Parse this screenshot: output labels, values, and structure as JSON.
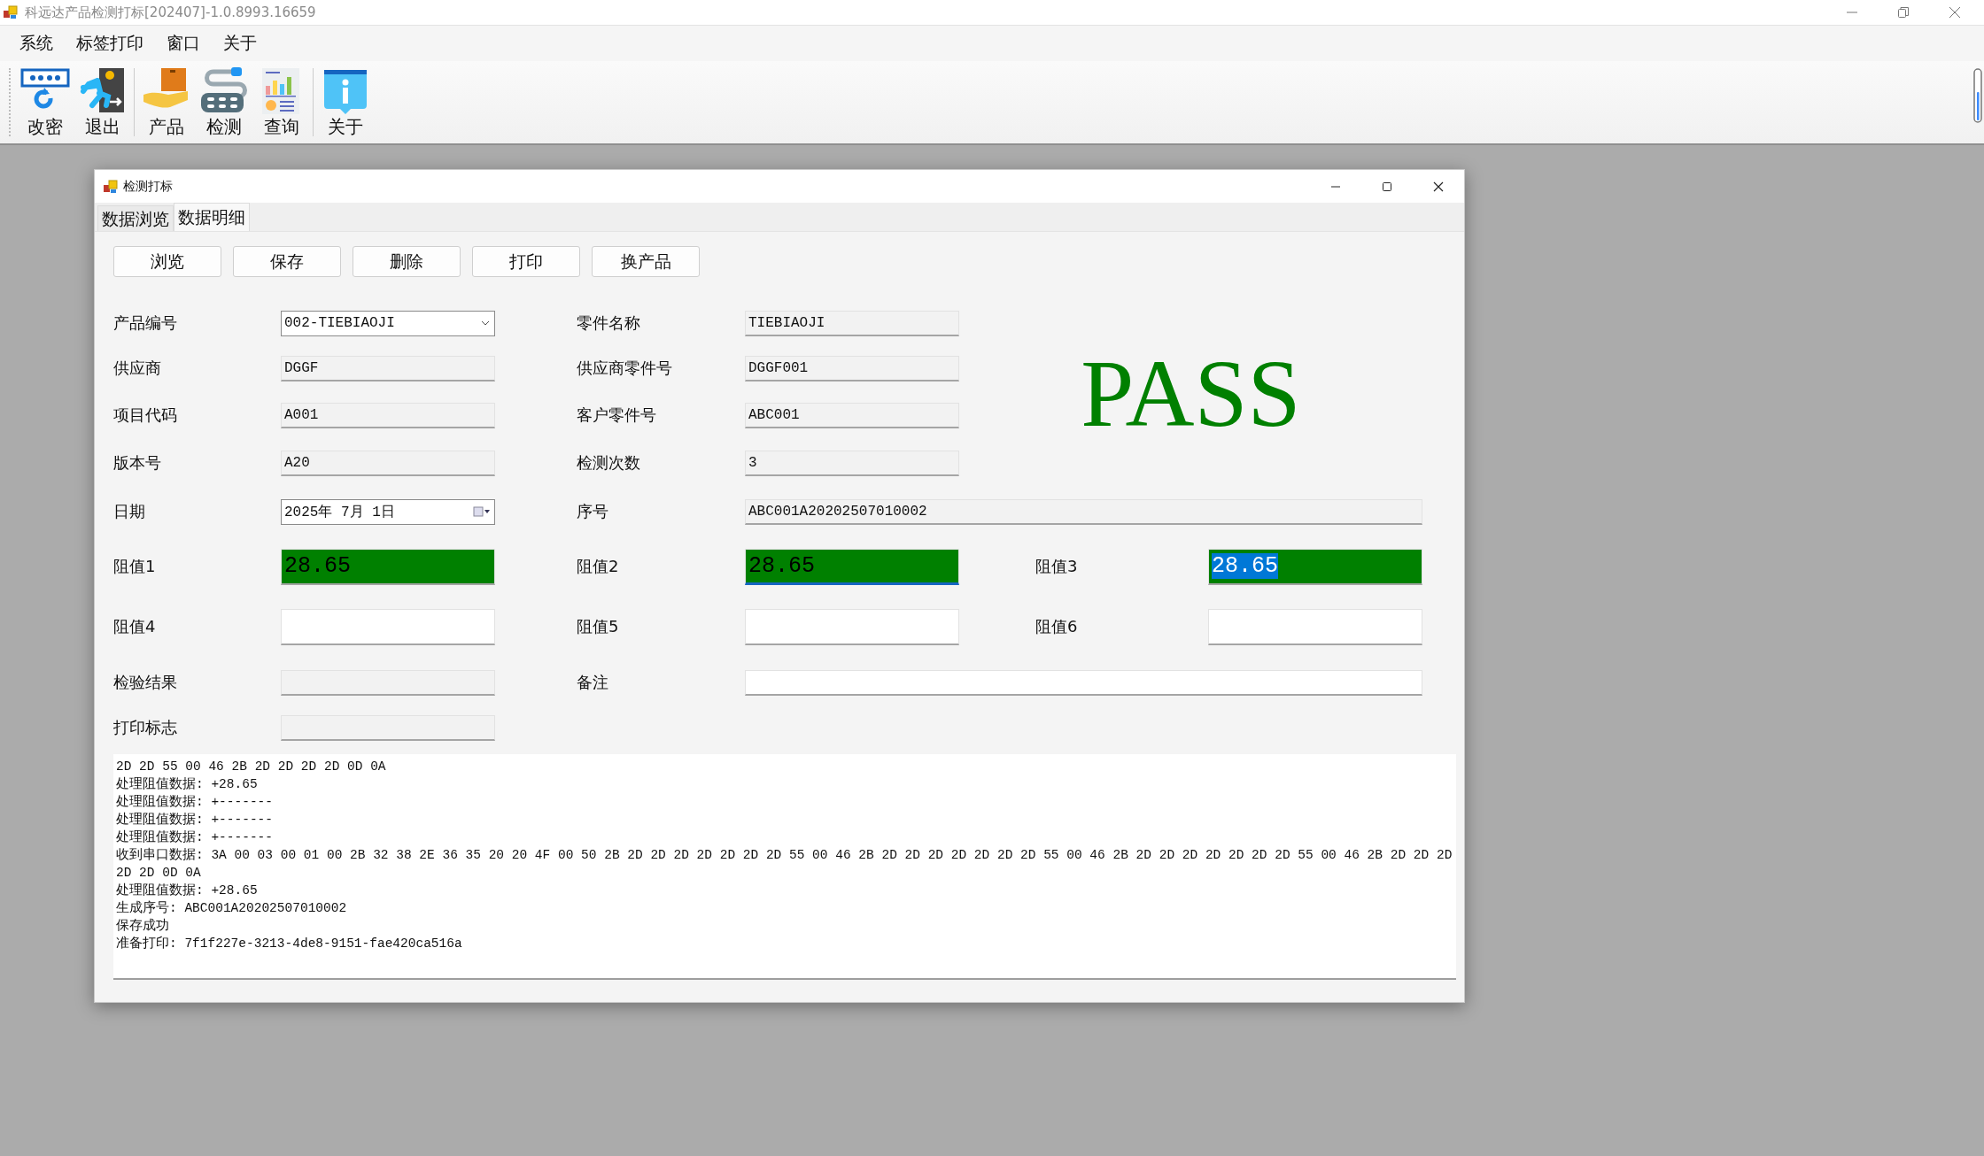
{
  "app": {
    "title": "科远达产品检测打标[202407]-1.0.8993.16659"
  },
  "menu": [
    "系统",
    "标签打印",
    "窗口",
    "关于"
  ],
  "toolbar": {
    "groups": [
      [
        {
          "label": "改密",
          "kind": "password"
        },
        {
          "label": "退出",
          "kind": "exit"
        }
      ],
      [
        {
          "label": "产品",
          "kind": "product"
        },
        {
          "label": "检测",
          "kind": "detect"
        },
        {
          "label": "查询",
          "kind": "query"
        }
      ],
      [
        {
          "label": "关于",
          "kind": "about"
        }
      ]
    ]
  },
  "child_window": {
    "title": "检测打标",
    "tabs": [
      {
        "label": "数据浏览",
        "selected": false
      },
      {
        "label": "数据明细",
        "selected": true
      }
    ],
    "buttons": [
      "浏览",
      "保存",
      "删除",
      "打印",
      "换产品"
    ],
    "rows": [
      [
        {
          "label": "产品编号",
          "kind": "combo",
          "value": "002-TIEBIAOJI"
        },
        {
          "label": "零件名称",
          "kind": "readonly",
          "value": "TIEBIAOJI"
        }
      ],
      [
        {
          "label": "供应商",
          "kind": "readonly",
          "value": "DGGF"
        },
        {
          "label": "供应商零件号",
          "kind": "readonly",
          "value": "DGGF001"
        }
      ],
      [
        {
          "label": "项目代码",
          "kind": "readonly",
          "value": "A001"
        },
        {
          "label": "客户零件号",
          "kind": "readonly",
          "value": "ABC001"
        }
      ],
      [
        {
          "label": "版本号",
          "kind": "readonly",
          "value": "A20"
        },
        {
          "label": "检测次数",
          "kind": "readonly",
          "value": "3"
        }
      ],
      [
        {
          "label": "日期",
          "kind": "date",
          "value": "2025年  7月  1日"
        },
        {
          "label": "序号",
          "kind": "readonly_wide",
          "value": "ABC001A20202507010002"
        }
      ],
      [
        {
          "label": "阻值1",
          "kind": "reading",
          "value": "28.65",
          "pass": true,
          "focused": false,
          "selected": false
        },
        {
          "label": "阻值2",
          "kind": "reading",
          "value": "28.65",
          "pass": true,
          "focused": true,
          "selected": false
        },
        {
          "label": "阻值3",
          "kind": "reading",
          "value": "28.65",
          "pass": true,
          "focused": false,
          "selected": true
        }
      ],
      [
        {
          "label": "阻值4",
          "kind": "reading",
          "pass": false,
          "focused": false,
          "selected": false
        },
        {
          "label": "阻值5",
          "kind": "reading",
          "pass": false,
          "focused": false,
          "selected": false
        },
        {
          "label": "阻值6",
          "kind": "reading",
          "pass": false,
          "focused": false,
          "selected": false
        }
      ],
      [
        {
          "label": "检验结果",
          "kind": "readonly"
        },
        {
          "label": "备注",
          "kind": "input_wide"
        }
      ],
      [
        {
          "label": "打印标志",
          "kind": "readonly"
        }
      ]
    ],
    "result": {
      "text": "PASS",
      "color": "#008000"
    },
    "log": [
      "2D 2D 55 00 46 2B 2D 2D 2D 2D 0D 0A",
      "处理阻值数据: +28.65",
      "处理阻值数据: +-------",
      "处理阻值数据: +-------",
      "处理阻值数据: +-------",
      "收到串口数据: 3A 00 03 00 01 00 2B 32 38 2E 36 35 20 20 4F 00 50 2B 2D 2D 2D 2D 2D 2D 2D 55 00 46 2B 2D 2D 2D 2D 2D 2D 2D 55 00 46 2B 2D 2D 2D 2D 2D 2D 2D 55 00 46 2B 2D 2D 2D 2D 2D 0D 0A",
      "处理阻值数据: +28.65",
      "生成序号: ABC001A20202507010002",
      "保存成功",
      "准备打印: 7f1f227e-3213-4de8-9151-fae420ca516a"
    ]
  }
}
